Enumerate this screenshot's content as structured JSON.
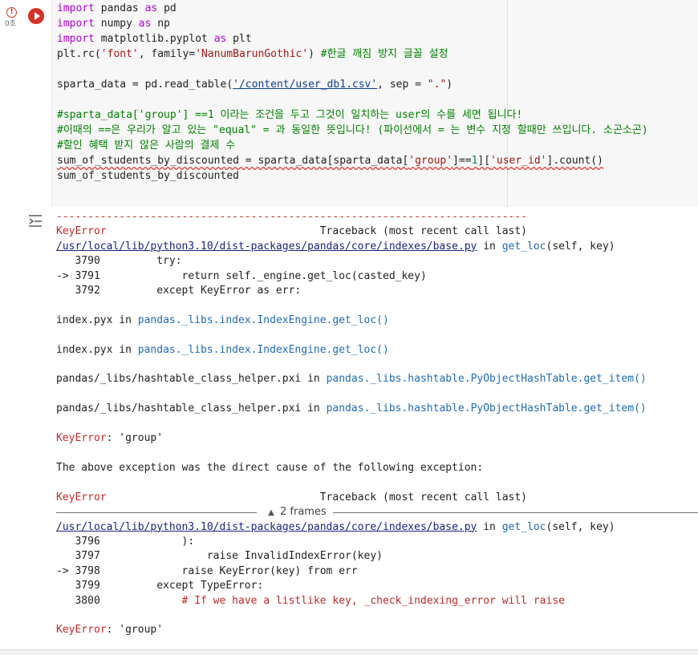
{
  "cell": {
    "status_icon": "!",
    "exec_time": "0초",
    "run_icon": "run-error-icon",
    "code_lines": [
      [
        "import",
        " pandas ",
        "as",
        " pd"
      ],
      [
        "import",
        " numpy ",
        "as",
        " np"
      ],
      [
        "import",
        " matplotlib.pyplot ",
        "as",
        " plt"
      ]
    ],
    "line4_a": "plt.rc(",
    "line4_s1": "'font'",
    "line4_b": ", family=",
    "line4_s2": "'NanumBarunGothic'",
    "line4_c": ") ",
    "line4_cm": "#한글 깨짐 방지 글꼴 설정",
    "line6_a": "sparta_data = pd.read_table(",
    "line6_s1": "'/content/user_db1.csv'",
    "line6_b": ", sep = ",
    "line6_s2": "\".\"",
    "line6_c": ")",
    "comment1": "#sparta_data['group'] ==1 이라는 조건을 두고 그것이 일치하는 user의 수를 세면 됩니다!",
    "comment2": "#이때의 ==은 우리가 알고 있는 \"equal\" = 과 동일한 뜻입니다! (파이선에서 = 는 변수 지정 할때만 쓰입니다. 소곤소곤)",
    "comment3": "#할인 혜택 받지 않은 사람의 결제 수",
    "line10_a": "sum_of_students_by_discounted = sparta_data[sparta_data[",
    "line10_s1": "'group'",
    "line10_b": "]==",
    "line10_n": "1",
    "line10_c": "][",
    "line10_s2": "'user_id'",
    "line10_d": "].count()",
    "line11": "sum_of_students_by_discounted"
  },
  "output": {
    "icon": "output-toggle-icon",
    "dashes": "---------------------------------------------------------------------------",
    "err_name": "KeyError",
    "traceback_hdr": "                                  Traceback (most recent call last)",
    "file1": "/usr/local/lib/python3.10/dist-packages/pandas/core/indexes/base.py",
    "in_kw": " in ",
    "func1": "get_loc",
    "args1": "(self, key)",
    "l3790": "   3790         try:",
    "l3791": "-> 3791             return self._engine.get_loc(casted_key)",
    "l3792": "   3792         except KeyError as err:",
    "f2": "index.pyx",
    "f2fn": "pandas._libs.index.IndexEngine.get_loc()",
    "f3": "index.pyx",
    "f3fn": "pandas._libs.index.IndexEngine.get_loc()",
    "f4": "pandas/_libs/hashtable_class_helper.pxi",
    "f4fn": "pandas._libs.hashtable.PyObjectHashTable.get_item()",
    "f5": "pandas/_libs/hashtable_class_helper.pxi",
    "f5fn": "pandas._libs.hashtable.PyObjectHashTable.get_item()",
    "keyerror1": "KeyError",
    "keyerror1_msg": ": 'group'",
    "cause": "The above exception was the direct cause of the following exception:",
    "err_name2": "KeyError",
    "traceback_hdr2": "                                  Traceback (most recent call last)",
    "frames": "2 frames",
    "file2": "/usr/local/lib/python3.10/dist-packages/pandas/core/indexes/base.py",
    "func2": "get_loc",
    "args2": "(self, key)",
    "l3796": "   3796             ):",
    "l3797": "   3797                 raise InvalidIndexError(key)",
    "l3798": "-> 3798             raise KeyError(key) from err",
    "l3799": "   3799         except TypeError:",
    "l3800a": "   3800             ",
    "l3800b": "# If we have a listlike key, _check_indexing_error will raise",
    "keyerror2": "KeyError",
    "keyerror2_msg": ": 'group'"
  }
}
